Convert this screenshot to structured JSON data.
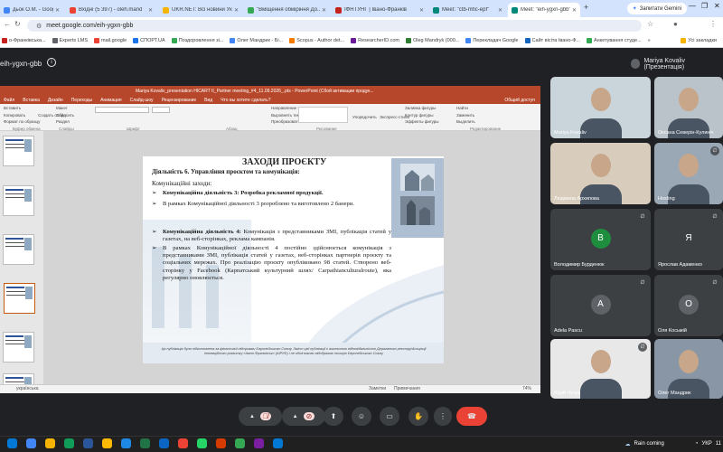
{
  "browser": {
    "tabs": [
      {
        "label": "дьок О.М. - Google А",
        "color": "#4285f4"
      },
      {
        "label": "Вхідні (5 397) - oleh.mand",
        "color": "#ea4335"
      },
      {
        "label": "UKR.NET: Всі новини Укр",
        "color": "#f4b400"
      },
      {
        "label": "\"Вміщення обміріння До...",
        "color": "#34a853"
      },
      {
        "label": "ІФНТУНГ | Івано-Франків",
        "color": "#c5221f"
      },
      {
        "label": "Meet: \"ctb-mfic-epf\"",
        "color": "#00897b"
      },
      {
        "label": "Meet: \"eih-ygxn-gbb\"",
        "color": "#00897b"
      }
    ],
    "new_tab": "+",
    "gemini_label": "Запитати Gemini",
    "window_controls": [
      "—",
      "❐",
      "✕"
    ],
    "url": "meet.google.com/eih-ygxn-gbb",
    "bookmarks": [
      {
        "label": "о-Франківська...",
        "color": "#c5221f"
      },
      {
        "label": "Experts LMS",
        "color": "#5f6368"
      },
      {
        "label": "mail.google",
        "color": "#ea4335"
      },
      {
        "label": "СПОРТ.UA",
        "color": "#1a73e8"
      },
      {
        "label": "Поздоровлення зі...",
        "color": "#34a853"
      },
      {
        "label": "Олег Мандрик - Бі...",
        "color": "#4285f4"
      },
      {
        "label": "Scopus - Author det...",
        "color": "#f57c00"
      },
      {
        "label": "ResearcherID.com",
        "color": "#6a1b9a"
      },
      {
        "label": "Oleg Mandryk (000...",
        "color": "#2e7d32"
      },
      {
        "label": "Перекладач Google",
        "color": "#4285f4"
      },
      {
        "label": "Сайт вісіта Івано-Ф...",
        "color": "#1565c0"
      },
      {
        "label": "Анкетування студе...",
        "color": "#34a853"
      },
      {
        "label": "»",
        "color": ""
      },
      {
        "label": "Усі закладки",
        "color": "#f4b400"
      }
    ]
  },
  "meet": {
    "meeting_code": "eih-ygxn-gbb",
    "presenter_label": "Mariya Kovaliv (Презентація)",
    "participants": [
      {
        "name": "Mariya Kovaliv",
        "type": "video",
        "bg": "#c9d4db"
      },
      {
        "name": "Оксана Северін-Кулинiч",
        "type": "video",
        "bg": "#b9c3c9"
      },
      {
        "name": "Людмила Архипова",
        "type": "video",
        "bg": "#d8cdbd"
      },
      {
        "name": "Hosting",
        "type": "video",
        "bg": "#9aa7b4"
      },
      {
        "name": "Володимир Бурденюк",
        "type": "avatar",
        "initial": "В",
        "avatar_color": "#1e8e3e"
      },
      {
        "name": "Ярослав Адаменко",
        "type": "avatar",
        "initial": "Я",
        "avatar_color": "#3c4043"
      },
      {
        "name": "Adela Pascu",
        "type": "avatar",
        "initial": "A",
        "avatar_color": "#5f6368"
      },
      {
        "name": "Оля Косьмій",
        "type": "avatar",
        "initial": "O",
        "avatar_color": "#5f6368"
      },
      {
        "name": "Юрій Чучук",
        "type": "video",
        "bg": "#e8e8e8"
      },
      {
        "name": "Олег Мандрик",
        "type": "video",
        "bg": "#8896a6"
      }
    ],
    "controls": [
      "mic-off",
      "camera-off",
      "present",
      "emoji",
      "captions",
      "raise-hand",
      "more",
      "leave-call"
    ]
  },
  "powerpoint": {
    "title_bar": "Mariya Kovaliv_presentation HICART II_Partner meeting_#4_11.09.2026_.pts - PowerPoint (Сбой активации продук...",
    "menu": [
      "Файл",
      "Вставка",
      "Дизайн",
      "Переходы",
      "Анимация",
      "Слайд-шоу",
      "Рецензирование",
      "Вид",
      "Что вы хотите сделать?"
    ],
    "share_label": "Общий доступ",
    "ribbon_groups": [
      "Буфер обмена",
      "Слайды",
      "Шрифт",
      "Абзац",
      "Рисование",
      "Редактирование"
    ],
    "ribbon_items": [
      "Вставить",
      "Копировать",
      "Формат по образцу",
      "Создать слайд",
      "Макет",
      "Сбросить",
      "Раздел",
      "Направление текста",
      "Выровнять текст",
      "Преобразовать в SmartArt",
      "Упорядочить",
      "Экспресс-стили",
      "Заливка фигуры",
      "Контур фигуры",
      "Эффекты фигуры",
      "Найти",
      "Заменить",
      "Выделить"
    ],
    "status_left": "українська",
    "status_right": [
      "Заметки",
      "Примечания",
      "74%"
    ],
    "slide": {
      "title": "ЗАХОДИ ПРОЄКТУ",
      "heading": "Діяльність 6. Управління проєктом та комунікація:",
      "subheading": "Комунікаційні заходи:",
      "bullets": [
        {
          "text": "Комунікаційна діяльність 3: Розробка рекламної продукції.",
          "bold": true
        },
        {
          "text": "В рамках Комунікаційної діяльності 3 розроблено та виготовлено 2 банери.",
          "bold": false
        },
        {
          "text_bold": "Комунікаційна діяльність 4:",
          "text": " Комунікація з представниками ЗМІ, публікація статей у газетах, на веб-сторінках, реклама кампанія."
        },
        {
          "text": "В рамках Комунікаційної діяльності 4 постійно здійснюється комунікація з представниками ЗМІ, публікація статей у газетах, веб-сторінках партнерів проєкту та соціальних мережах. Про реалізацію проєкту опубліковано 98 статей. Створено веб-сторінку у Facebook (Карпатський культурний шлях/ Carpathianculturalroute), яка регулярно оновлюється.",
          "bold": false
        }
      ],
      "bullet_mark": "➢",
      "footer": "Ця публікація була підготовлена за фінансової підтримки Європейського Союзу. Зміст цієї публікації є виключною відповідальністю Державного реєстру/Асоціації інноваційного розвитку «Івано-Франківськ» (АІРУФ) і не обов'язково відображає позицію Європейського Союзу"
    }
  },
  "taskbar": {
    "weather": "Rain coming",
    "lang": "УКР",
    "time": "11"
  }
}
